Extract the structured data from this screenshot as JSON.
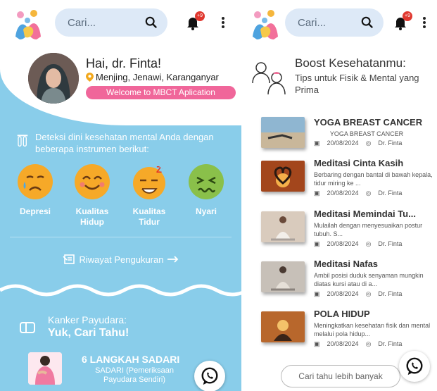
{
  "left": {
    "search": {
      "placeholder": "Cari..."
    },
    "notif_count": "+9",
    "greeting": "Hai, dr. Finta!",
    "location": "Menjing, Jenawi, Karanganyar",
    "welcome": "Welcome to MBCT Aplication",
    "deteksi_text": "Deteksi dini kesehatan mental Anda dengan beberapa instrumen berikut:",
    "instruments": [
      {
        "label": "Depresi",
        "icon": "sad-face-icon",
        "color": "#f6a928"
      },
      {
        "label": "Kualitas Hidup",
        "icon": "smile-face-icon",
        "color": "#f6a928"
      },
      {
        "label": "Kualitas Tidur",
        "icon": "sleepy-face-icon",
        "color": "#f6a928"
      },
      {
        "label": "Nyari",
        "icon": "sick-face-icon",
        "color": "#8ac04a"
      }
    ],
    "riwayat": "Riwayat Pengukuran",
    "kanker_line1": "Kanker Payudara:",
    "kanker_line2": "Yuk, Cari Tahu!",
    "sadari_title": "6 LANGKAH SADARI",
    "sadari_sub": "SADARI (Pemeriksaan Payudara Sendiri)"
  },
  "right": {
    "search": {
      "placeholder": "Cari..."
    },
    "notif_count": "+9",
    "boost_title": "Boost Kesehatanmu:",
    "boost_sub": "Tips untuk Fisik & Mental yang Prima",
    "articles": [
      {
        "title": "YOGA BREAST CANCER",
        "summary": "YOGA BREAST CANCER",
        "date": "20/08/2024",
        "author": "Dr. Finta"
      },
      {
        "title": "Meditasi Cinta Kasih",
        "summary": "Berbaring dengan bantal di bawah kepala, tidur miring ke ...",
        "date": "20/08/2024",
        "author": "Dr. Finta"
      },
      {
        "title": "Meditasi Memindai Tu...",
        "summary": "Mulailah dengan menyesuaikan postur tubuh. S...",
        "date": "20/08/2024",
        "author": "Dr. Finta"
      },
      {
        "title": "Meditasi Nafas",
        "summary": "Ambil posisi duduk senyaman mungkin diatas kursi atau di a...",
        "date": "20/08/2024",
        "author": "Dr. Finta"
      },
      {
        "title": "POLA HIDUP",
        "summary": "Meningkatkan kesehatan fisik dan mental melalui pola hidup...",
        "date": "20/08/2024",
        "author": "Dr. Finta"
      }
    ],
    "cari_tahu": "Cari tahu  lebih banyak"
  },
  "colors": {
    "sky": "#89cdea",
    "pink": "#f0669a",
    "whatsapp": "#1a1a1a"
  }
}
